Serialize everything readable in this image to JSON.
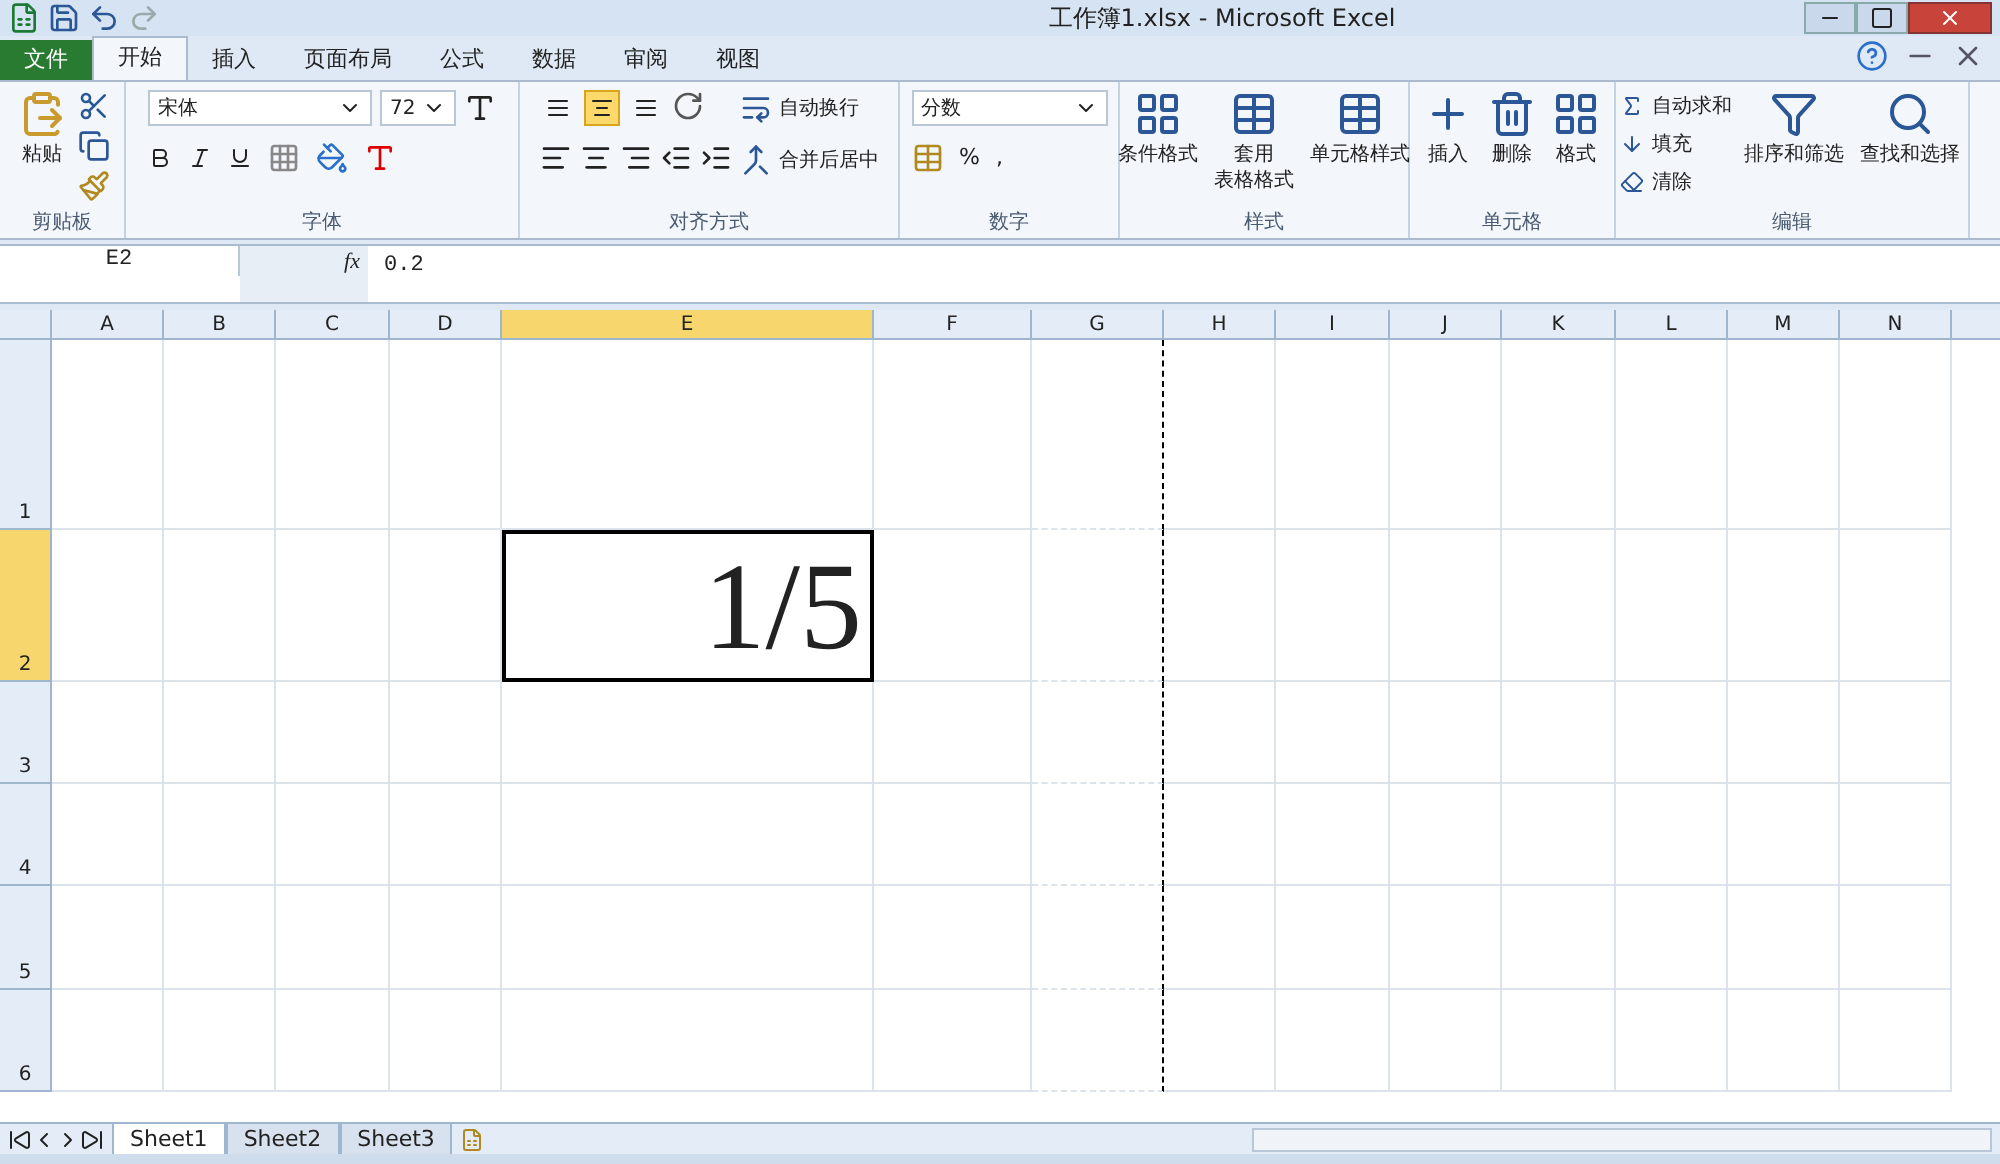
{
  "window": {
    "title": "工作簿1.xlsx - Microsoft Excel"
  },
  "tabs": [
    {
      "label": "文件",
      "kind": "file",
      "selected": false
    },
    {
      "label": "开始",
      "kind": "tab",
      "selected": true
    },
    {
      "label": "插入",
      "kind": "tab",
      "selected": false
    },
    {
      "label": "页面布局",
      "kind": "tab",
      "selected": false
    },
    {
      "label": "公式",
      "kind": "tab",
      "selected": false
    },
    {
      "label": "数据",
      "kind": "tab",
      "selected": false
    },
    {
      "label": "审阅",
      "kind": "tab",
      "selected": false
    },
    {
      "label": "视图",
      "kind": "tab",
      "selected": false
    }
  ],
  "ribbon": {
    "clipboard": {
      "label": "剪贴板",
      "paste": "粘贴"
    },
    "font": {
      "label": "字体",
      "name": "宋体",
      "size": "72"
    },
    "alignment": {
      "label": "对齐方式",
      "vertical": [
        {
          "selected": false
        },
        {
          "selected": true
        },
        {
          "selected": false
        }
      ],
      "wrap": "自动换行",
      "merge": "合并后居中"
    },
    "number": {
      "label": "数字",
      "format": "分数",
      "percent": "%",
      "comma": ","
    },
    "styles": {
      "label": "样式",
      "buttons": [
        {
          "lines": [
            "条件格式"
          ]
        },
        {
          "lines": [
            "套用",
            "表格格式"
          ]
        },
        {
          "lines": [
            "单元格样式"
          ]
        }
      ]
    },
    "cells": {
      "label": "单元格",
      "buttons": [
        "插入",
        "删除",
        "格式"
      ]
    },
    "editing": {
      "label": "编辑",
      "small": [
        "自动求和",
        "填充",
        "清除"
      ],
      "large": [
        "排序和筛选",
        "查找和选择"
      ]
    }
  },
  "formula_bar": {
    "name_box": "E2",
    "function_label": "fx",
    "formula": "0.2"
  },
  "columns": [
    {
      "label": "A",
      "selected": false
    },
    {
      "label": "B",
      "selected": false
    },
    {
      "label": "C",
      "selected": false
    },
    {
      "label": "D",
      "selected": false
    },
    {
      "label": "E",
      "selected": true
    },
    {
      "label": "F",
      "selected": false
    },
    {
      "label": "G",
      "selected": false
    },
    {
      "label": "H",
      "selected": false
    },
    {
      "label": "I",
      "selected": false
    },
    {
      "label": "J",
      "selected": false
    },
    {
      "label": "K",
      "selected": false
    },
    {
      "label": "L",
      "selected": false
    },
    {
      "label": "M",
      "selected": false
    },
    {
      "label": "N",
      "selected": false
    }
  ],
  "rows": [
    {
      "label": "1",
      "selected": false
    },
    {
      "label": "2",
      "selected": true
    },
    {
      "label": "3",
      "selected": false
    },
    {
      "label": "4",
      "selected": false
    },
    {
      "label": "5",
      "selected": false
    },
    {
      "label": "6",
      "selected": false
    }
  ],
  "active_cell": {
    "value": "1/5"
  },
  "sheets": [
    {
      "label": "Sheet1",
      "selected": true
    },
    {
      "label": "Sheet2",
      "selected": false
    },
    {
      "label": "Sheet3",
      "selected": false
    }
  ]
}
